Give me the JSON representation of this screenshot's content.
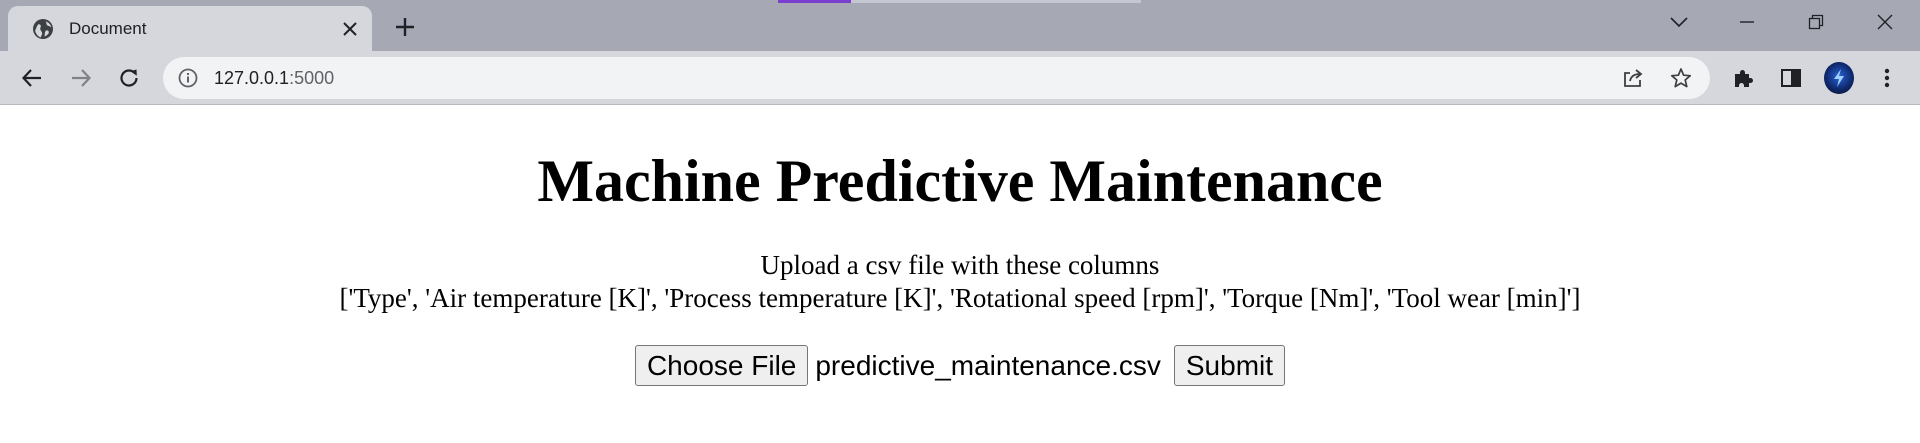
{
  "browser": {
    "tab": {
      "title": "Document"
    },
    "address": {
      "host": "127.0.0.1",
      "port": ":5000"
    },
    "icons": {
      "favicon": "globe-icon",
      "tab_close": "close-icon",
      "new_tab": "plus-icon",
      "tab_search": "chevron-down-icon",
      "minimize": "minimize-icon",
      "restore": "restore-icon",
      "window_close": "close-icon",
      "back": "arrow-left-icon",
      "forward": "arrow-right-icon",
      "reload": "reload-icon",
      "site_info": "info-icon",
      "share": "share-icon",
      "bookmark": "star-icon",
      "extensions": "puzzle-icon",
      "side_panel": "side-panel-icon",
      "profile": "avatar-icon",
      "menu": "kebab-menu-icon"
    },
    "colors": {
      "accent_loading": "#7b3fd0",
      "tabstrip": "#a6a9b4",
      "toolbar": "#d5d7dd"
    }
  },
  "page": {
    "title": "Machine Predictive Maintenance",
    "instructions": {
      "line1": "Upload a csv file with these columns",
      "line2": "['Type', 'Air temperature [K]', 'Process temperature [K]', 'Rotational speed [rpm]', 'Torque [Nm]', 'Tool wear [min]']"
    },
    "form": {
      "choose_file_label": "Choose File",
      "file_name": "predictive_maintenance.csv",
      "submit_label": "Submit"
    }
  }
}
